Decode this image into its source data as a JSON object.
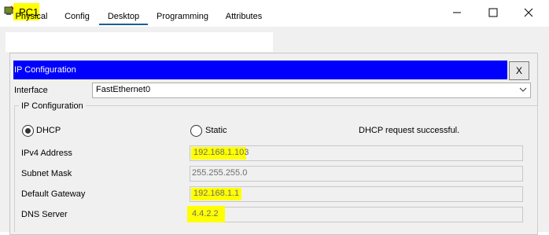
{
  "window": {
    "title": "PC1",
    "icon": "pc-icon",
    "controls": [
      "minimize-icon",
      "maximize-icon",
      "close-icon"
    ]
  },
  "tabs": [
    {
      "label": "Physical",
      "active": false
    },
    {
      "label": "Config",
      "active": false
    },
    {
      "label": "Desktop",
      "active": true
    },
    {
      "label": "Programming",
      "active": false
    },
    {
      "label": "Attributes",
      "active": false
    }
  ],
  "ip_config": {
    "header": "IP Configuration",
    "close_label": "X",
    "interface_label": "Interface",
    "interface_value": "FastEthernet0",
    "group_title": "IP Configuration",
    "dhcp_label": "DHCP",
    "static_label": "Static",
    "selected_mode": "DHCP",
    "status": "DHCP request successful.",
    "fields": [
      {
        "label": "IPv4 Address",
        "value": "192.168.1.103",
        "highlighted": true
      },
      {
        "label": "Subnet Mask",
        "value": "255.255.255.0",
        "highlighted": false
      },
      {
        "label": "Default Gateway",
        "value": "192.168.1.1",
        "highlighted": true
      },
      {
        "label": "DNS Server",
        "value": "4.4.2.2",
        "highlighted": true
      }
    ]
  },
  "colors": {
    "header_blue": "#0000ff",
    "highlight": "#ffff00",
    "tab_underline": "#1f5d94"
  }
}
